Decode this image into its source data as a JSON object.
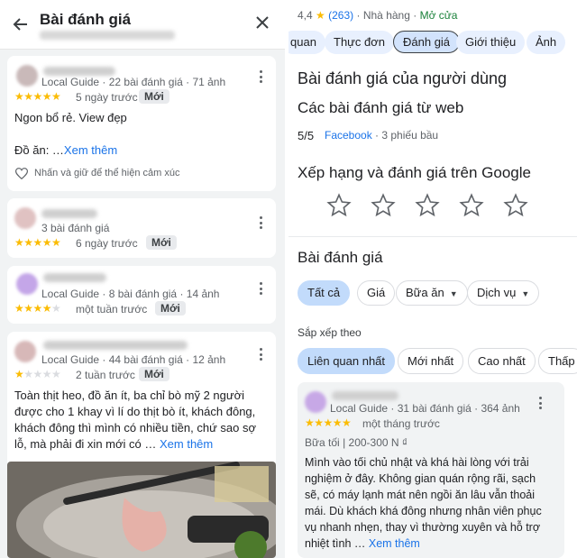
{
  "left": {
    "header": {
      "title": "Bài đánh giá"
    },
    "reviews": [
      {
        "meta": "Local Guide · 22 bài đánh giá · 71 ảnh",
        "rating": 5,
        "time": "5 ngày trước",
        "badge": "Mới",
        "text1": "Ngon bổ rẻ. View đẹp",
        "text2_prefix": "Đồ ăn: …",
        "more": "Xem thêm",
        "like": "Nhấn và giữ để thể hiện cảm xúc"
      },
      {
        "meta": "3 bài đánh giá",
        "rating": 5,
        "time": "6 ngày trước",
        "badge": "Mới"
      },
      {
        "meta": "Local Guide · 8 bài đánh giá · 14 ảnh",
        "rating": 4,
        "time": "một tuần trước",
        "badge": "Mới"
      },
      {
        "meta": "Local Guide · 44 bài đánh giá · 12 ảnh",
        "rating": 1,
        "time": "2 tuần trước",
        "badge": "Mới",
        "body_lines": [
          "Toàn thịt heo, đồ ăn ít, ba chỉ bò mỹ 2 người",
          "được cho 1 khay vì lí do thịt bò ít, khách đông,",
          "khách đông thì mình có nhiều tiền, chứ sao sợ",
          "lỗ, mà phải đi xin mới có … "
        ],
        "more": "Xem thêm"
      }
    ]
  },
  "right": {
    "rating": "4,4",
    "review_count": "(263)",
    "category": "Nhà hàng",
    "status": "Mở cửa",
    "tabs": [
      "quan",
      "Thực đơn",
      "Đánh giá",
      "Giới thiệu",
      "Ảnh"
    ],
    "active_tab": "Đánh giá",
    "user_reviews_title": "Bài đánh giá của người dùng",
    "web_reviews_title": "Các bài đánh giá từ web",
    "web_score": "5/5",
    "web_source": "Facebook",
    "web_count": "· 3 phiếu bầu",
    "google_rate_title": "Xếp hạng và đánh giá trên Google",
    "reviews_title": "Bài đánh giá",
    "filters": [
      "Tất cả",
      "Giá",
      "Bữa ăn",
      "Dịch vụ"
    ],
    "sort_label": "Sắp xếp theo",
    "sorts": [
      "Liên quan nhất",
      "Mới nhất",
      "Cao nhất",
      "Thấp"
    ],
    "review": {
      "meta": "Local Guide · 31 bài đánh giá · 364 ảnh",
      "rating": 5,
      "time": "một tháng trước",
      "meal": "Bữa tối",
      "price": "200-300 N ₫",
      "body_lines": [
        "Mình vào tối chủ nhật và khá hài lòng với trải",
        "nghiệm ở đây. Không gian quán rộng rãi, sạch",
        "sẽ, có máy lạnh mát nên ngồi ăn lâu vẫn thoải",
        "mái. Dù khách khá đông nhưng nhân viên phục",
        "vụ nhanh nhẹn, thay vì thường xuyên và hỗ trợ",
        "nhiệt tình … "
      ],
      "more": "Xem thêm"
    },
    "colors": {
      "accent": "#1a73e8",
      "star": "#fbbc04",
      "open": "#188038",
      "chip_selected": "#c2dbfb"
    }
  }
}
